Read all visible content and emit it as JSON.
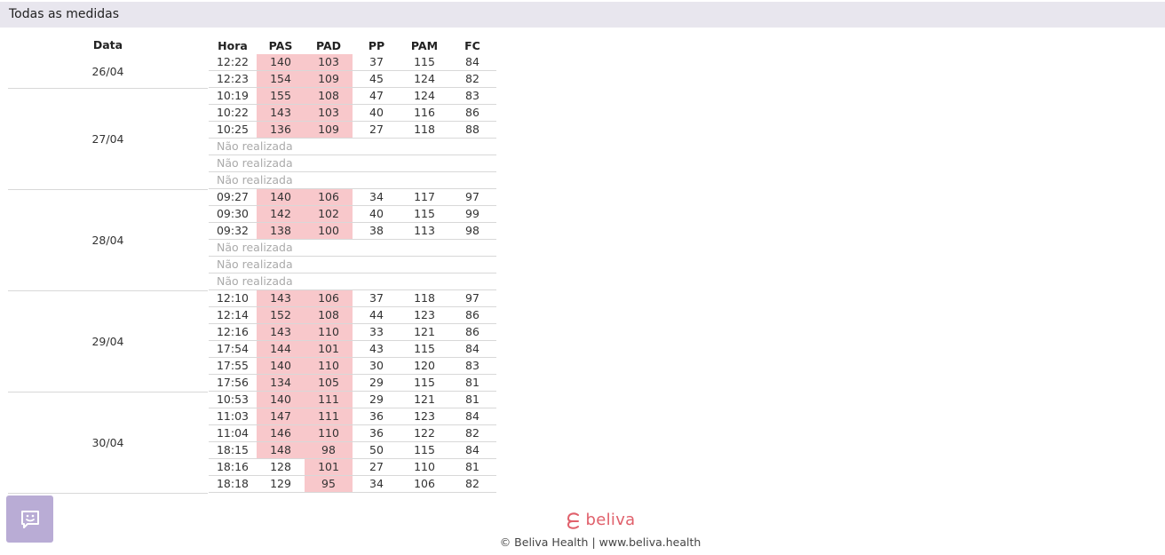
{
  "page": {
    "title": "Todas as medidas"
  },
  "columns": {
    "date": "Data",
    "time": "Hora",
    "pas": "PAS",
    "pad": "PAD",
    "pp": "PP",
    "pam": "PAM",
    "fc": "FC"
  },
  "groups": [
    {
      "date": "26/04",
      "rows": [
        {
          "time": "12:22",
          "pas": "140",
          "pad": "103",
          "pp": "37",
          "pam": "115",
          "fc": "84",
          "pas_high": true,
          "pad_high": true
        },
        {
          "time": "12:23",
          "pas": "154",
          "pad": "109",
          "pp": "45",
          "pam": "124",
          "fc": "82",
          "pas_high": true,
          "pad_high": true
        }
      ]
    },
    {
      "date": "27/04",
      "rows": [
        {
          "time": "10:19",
          "pas": "155",
          "pad": "108",
          "pp": "47",
          "pam": "124",
          "fc": "83",
          "pas_high": true,
          "pad_high": true
        },
        {
          "time": "10:22",
          "pas": "143",
          "pad": "103",
          "pp": "40",
          "pam": "116",
          "fc": "86",
          "pas_high": true,
          "pad_high": true
        },
        {
          "time": "10:25",
          "pas": "136",
          "pad": "109",
          "pp": "27",
          "pam": "118",
          "fc": "88",
          "pas_high": true,
          "pad_high": true
        },
        {
          "not_done": "Não realizada"
        },
        {
          "not_done": "Não realizada"
        },
        {
          "not_done": "Não realizada"
        }
      ]
    },
    {
      "date": "28/04",
      "rows": [
        {
          "time": "09:27",
          "pas": "140",
          "pad": "106",
          "pp": "34",
          "pam": "117",
          "fc": "97",
          "pas_high": true,
          "pad_high": true
        },
        {
          "time": "09:30",
          "pas": "142",
          "pad": "102",
          "pp": "40",
          "pam": "115",
          "fc": "99",
          "pas_high": true,
          "pad_high": true
        },
        {
          "time": "09:32",
          "pas": "138",
          "pad": "100",
          "pp": "38",
          "pam": "113",
          "fc": "98",
          "pas_high": true,
          "pad_high": true
        },
        {
          "not_done": "Não realizada"
        },
        {
          "not_done": "Não realizada"
        },
        {
          "not_done": "Não realizada"
        }
      ]
    },
    {
      "date": "29/04",
      "rows": [
        {
          "time": "12:10",
          "pas": "143",
          "pad": "106",
          "pp": "37",
          "pam": "118",
          "fc": "97",
          "pas_high": true,
          "pad_high": true
        },
        {
          "time": "12:14",
          "pas": "152",
          "pad": "108",
          "pp": "44",
          "pam": "123",
          "fc": "86",
          "pas_high": true,
          "pad_high": true
        },
        {
          "time": "12:16",
          "pas": "143",
          "pad": "110",
          "pp": "33",
          "pam": "121",
          "fc": "86",
          "pas_high": true,
          "pad_high": true
        },
        {
          "time": "17:54",
          "pas": "144",
          "pad": "101",
          "pp": "43",
          "pam": "115",
          "fc": "84",
          "pas_high": true,
          "pad_high": true
        },
        {
          "time": "17:55",
          "pas": "140",
          "pad": "110",
          "pp": "30",
          "pam": "120",
          "fc": "83",
          "pas_high": true,
          "pad_high": true
        },
        {
          "time": "17:56",
          "pas": "134",
          "pad": "105",
          "pp": "29",
          "pam": "115",
          "fc": "81",
          "pas_high": true,
          "pad_high": true
        }
      ]
    },
    {
      "date": "30/04",
      "rows": [
        {
          "time": "10:53",
          "pas": "140",
          "pad": "111",
          "pp": "29",
          "pam": "121",
          "fc": "81",
          "pas_high": true,
          "pad_high": true
        },
        {
          "time": "11:03",
          "pas": "147",
          "pad": "111",
          "pp": "36",
          "pam": "123",
          "fc": "84",
          "pas_high": true,
          "pad_high": true
        },
        {
          "time": "11:04",
          "pas": "146",
          "pad": "110",
          "pp": "36",
          "pam": "122",
          "fc": "82",
          "pas_high": true,
          "pad_high": true
        },
        {
          "time": "18:15",
          "pas": "148",
          "pad": "98",
          "pp": "50",
          "pam": "115",
          "fc": "84",
          "pas_high": true,
          "pad_high": true
        },
        {
          "time": "18:16",
          "pas": "128",
          "pad": "101",
          "pp": "27",
          "pam": "110",
          "fc": "81",
          "pas_high": false,
          "pad_high": true
        },
        {
          "time": "18:18",
          "pas": "129",
          "pad": "95",
          "pp": "34",
          "pam": "106",
          "fc": "82",
          "pas_high": false,
          "pad_high": true
        }
      ]
    }
  ],
  "colors": {
    "high_value_bg": "#f8c8cb",
    "header_bg": "#e8e6ee",
    "brand": "#e0606b",
    "chat_button_bg": "#b9acd5"
  },
  "icons": {
    "chat": "chat-bubble-smile-icon",
    "logo": "beliva-logo-icon"
  },
  "footer": {
    "logo_text": "beliva",
    "copyright": "© Beliva Health | www.beliva.health"
  }
}
